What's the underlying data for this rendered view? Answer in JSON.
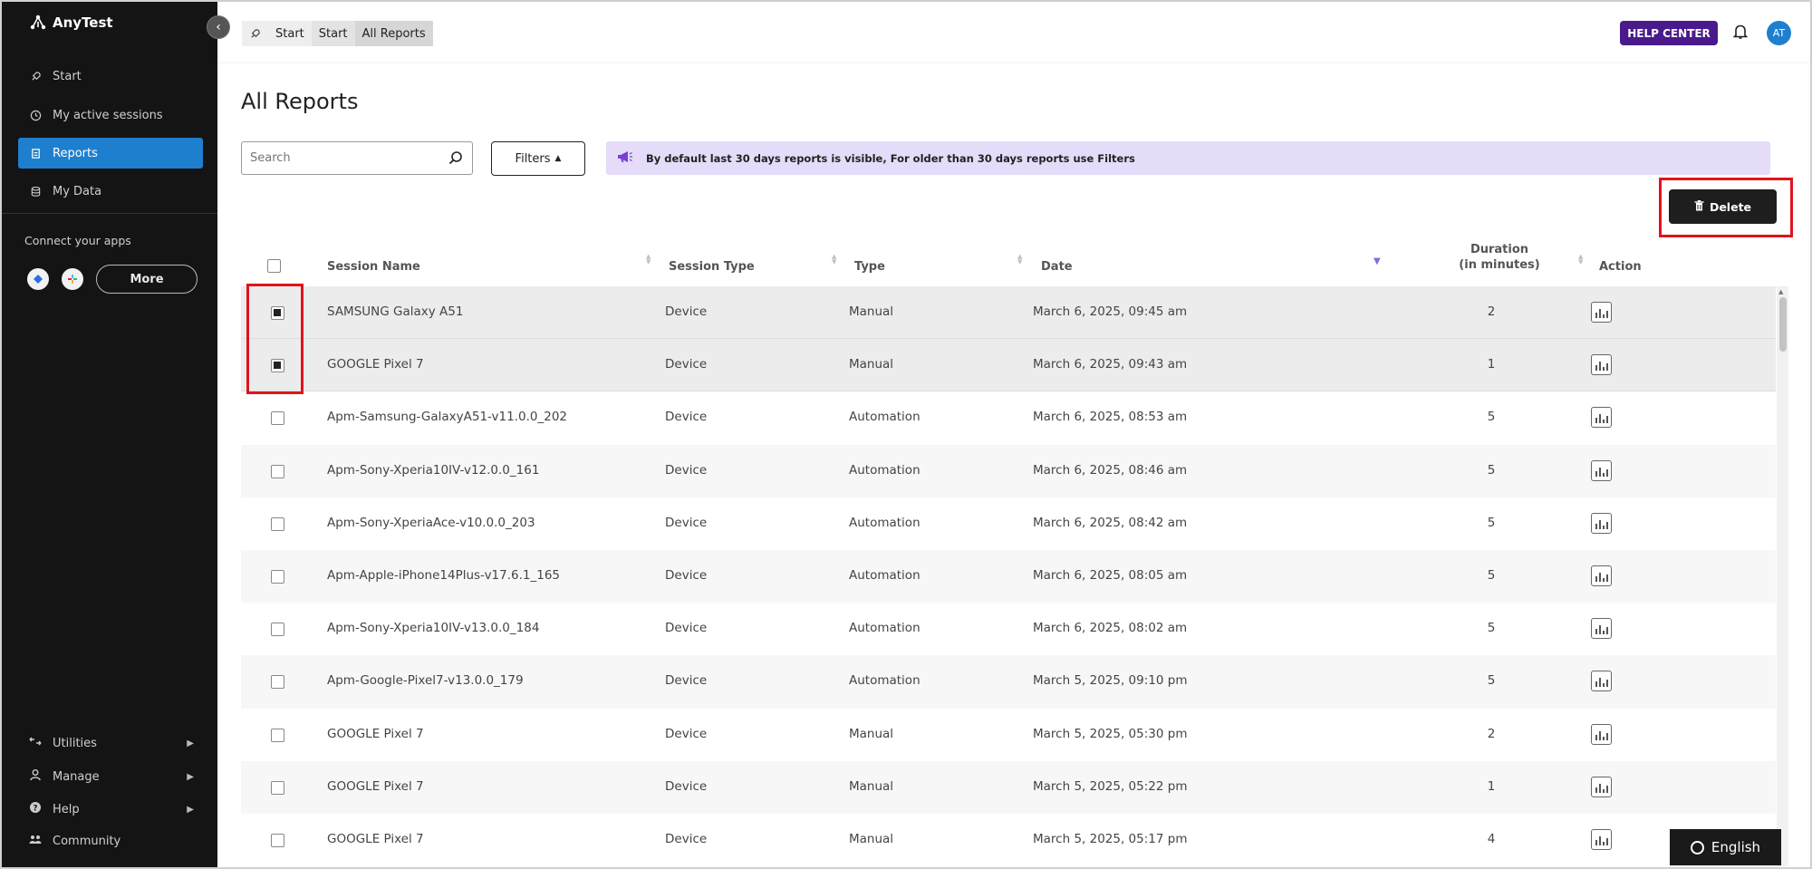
{
  "sidebar": {
    "brand": "AnyTest",
    "nav": [
      {
        "label": "Start",
        "icon": "rocket-icon"
      },
      {
        "label": "My active sessions",
        "icon": "clock-icon"
      },
      {
        "label": "Reports",
        "icon": "report-icon",
        "active": true
      },
      {
        "label": "My Data",
        "icon": "database-icon"
      }
    ],
    "connect_label": "Connect your apps",
    "more_label": "More",
    "bottom": [
      {
        "label": "Utilities",
        "icon": "utilities-icon"
      },
      {
        "label": "Manage",
        "icon": "user-icon"
      },
      {
        "label": "Help",
        "icon": "help-icon"
      },
      {
        "label": "Community",
        "icon": "community-icon"
      }
    ]
  },
  "header": {
    "breadcrumb": [
      "Start",
      "Start",
      "All Reports"
    ],
    "help_center": "HELP CENTER",
    "avatar_initials": "AT"
  },
  "main": {
    "title": "All Reports",
    "search_placeholder": "Search",
    "filters_label": "Filters",
    "notice": "By default last 30 days reports is visible, For older than 30 days reports use Filters",
    "delete_label": "Delete"
  },
  "table": {
    "columns": {
      "session_name": "Session Name",
      "session_type": "Session Type",
      "type": "Type",
      "date": "Date",
      "duration_line1": "Duration",
      "duration_line2": "(in minutes)",
      "action": "Action"
    },
    "rows": [
      {
        "name": "SAMSUNG Galaxy A51",
        "session_type": "Device",
        "type": "Manual",
        "date": "March 6, 2025, 09:45 am",
        "duration": "2",
        "checked": true
      },
      {
        "name": "GOOGLE Pixel 7",
        "session_type": "Device",
        "type": "Manual",
        "date": "March 6, 2025, 09:43 am",
        "duration": "1",
        "checked": true
      },
      {
        "name": "Apm-Samsung-GalaxyA51-v11.0.0_202",
        "session_type": "Device",
        "type": "Automation",
        "date": "March 6, 2025, 08:53 am",
        "duration": "5",
        "checked": false
      },
      {
        "name": "Apm-Sony-Xperia10IV-v12.0.0_161",
        "session_type": "Device",
        "type": "Automation",
        "date": "March 6, 2025, 08:46 am",
        "duration": "5",
        "checked": false
      },
      {
        "name": "Apm-Sony-XperiaAce-v10.0.0_203",
        "session_type": "Device",
        "type": "Automation",
        "date": "March 6, 2025, 08:42 am",
        "duration": "5",
        "checked": false
      },
      {
        "name": "Apm-Apple-iPhone14Plus-v17.6.1_165",
        "session_type": "Device",
        "type": "Automation",
        "date": "March 6, 2025, 08:05 am",
        "duration": "5",
        "checked": false
      },
      {
        "name": "Apm-Sony-Xperia10IV-v13.0.0_184",
        "session_type": "Device",
        "type": "Automation",
        "date": "March 6, 2025, 08:02 am",
        "duration": "5",
        "checked": false
      },
      {
        "name": "Apm-Google-Pixel7-v13.0.0_179",
        "session_type": "Device",
        "type": "Automation",
        "date": "March 5, 2025, 09:10 pm",
        "duration": "5",
        "checked": false
      },
      {
        "name": "GOOGLE Pixel 7",
        "session_type": "Device",
        "type": "Manual",
        "date": "March 5, 2025, 05:30 pm",
        "duration": "2",
        "checked": false
      },
      {
        "name": "GOOGLE Pixel 7",
        "session_type": "Device",
        "type": "Manual",
        "date": "March 5, 2025, 05:22 pm",
        "duration": "1",
        "checked": false
      },
      {
        "name": "GOOGLE Pixel 7",
        "session_type": "Device",
        "type": "Manual",
        "date": "March 5, 2025, 05:17 pm",
        "duration": "4",
        "checked": false
      }
    ]
  },
  "language": "English",
  "colors": {
    "accent": "#1f7fcf",
    "help": "#4a1a8c",
    "highlight": "#e0141c",
    "notice_bg": "#e4dcf8"
  }
}
